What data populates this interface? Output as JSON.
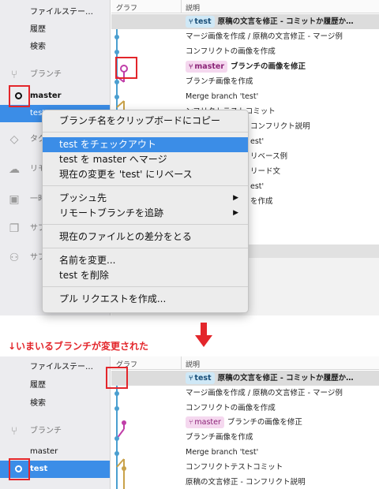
{
  "top": {
    "sidebar": {
      "items": [
        {
          "label": "ファイルステー…"
        },
        {
          "label": "履歴"
        },
        {
          "label": "検索"
        }
      ],
      "branches_section": "ブランチ",
      "branches": [
        "master",
        "test"
      ],
      "partial_labels": [
        "タグ",
        "リモ",
        "一時",
        "サブ",
        "サブ"
      ]
    },
    "columns": {
      "graph": "グラフ",
      "description": "説明"
    },
    "rows": [
      {
        "tag": "test",
        "text": "原稿の文言を修正 - コミットか履歴か…"
      },
      {
        "text": "マージ画像を作成 / 原稿の文言修正 - マージ例"
      },
      {
        "text": "コンフリクトの画像を作成"
      },
      {
        "tag": "master",
        "text": "ブランチの画像を修正"
      },
      {
        "text": "ブランチ画像を作成"
      },
      {
        "text": "Merge branch 'test'"
      },
      {
        "text": "ンフリクトテストコミット"
      },
      {
        "text": "コンフリクト説明"
      },
      {
        "text": "est'"
      },
      {
        "text": "リベース例"
      },
      {
        "text": "リード文"
      },
      {
        "text": "est'"
      },
      {
        "text": "を作成"
      }
    ]
  },
  "context_menu": {
    "groups": [
      [
        "ブランチ名をクリップボードにコピー"
      ],
      [
        "test をチェックアウト",
        "test を master へマージ",
        "現在の変更を 'test' にリベース"
      ],
      [
        "プッシュ先",
        "リモートブランチを追跡"
      ],
      [
        "現在のファイルとの差分をとる"
      ],
      [
        "名前を変更...",
        "test を削除"
      ],
      [
        "プル リクエストを作成..."
      ]
    ]
  },
  "annotation": "↓いまいるブランチが変更された",
  "bottom": {
    "sidebar": {
      "items": [
        {
          "label": "ファイルステー…"
        },
        {
          "label": "履歴"
        },
        {
          "label": "検索"
        }
      ],
      "branches_section": "ブランチ",
      "branches": [
        "master",
        "test"
      ]
    },
    "columns": {
      "graph": "グラフ",
      "description": "説明"
    },
    "rows": [
      {
        "tag": "test",
        "text": "原稿の文言を修正 - コミットか履歴か…"
      },
      {
        "text": "マージ画像を作成 / 原稿の文言修正 - マージ例"
      },
      {
        "text": "コンフリクトの画像を作成"
      },
      {
        "tag": "master",
        "text": "ブランチの画像を修正"
      },
      {
        "text": "ブランチ画像を作成"
      },
      {
        "text": "Merge branch 'test'"
      },
      {
        "text": "コンフリクトテストコミット"
      },
      {
        "text": "原稿の文言修正 - コンフリクト説明"
      }
    ]
  },
  "colors": {
    "selection_blue": "#3b8de7",
    "annotation_red": "#e3262b",
    "graph_blue": "#4b9fd0",
    "graph_pink": "#c03ea8",
    "graph_olive": "#c9a24a"
  }
}
